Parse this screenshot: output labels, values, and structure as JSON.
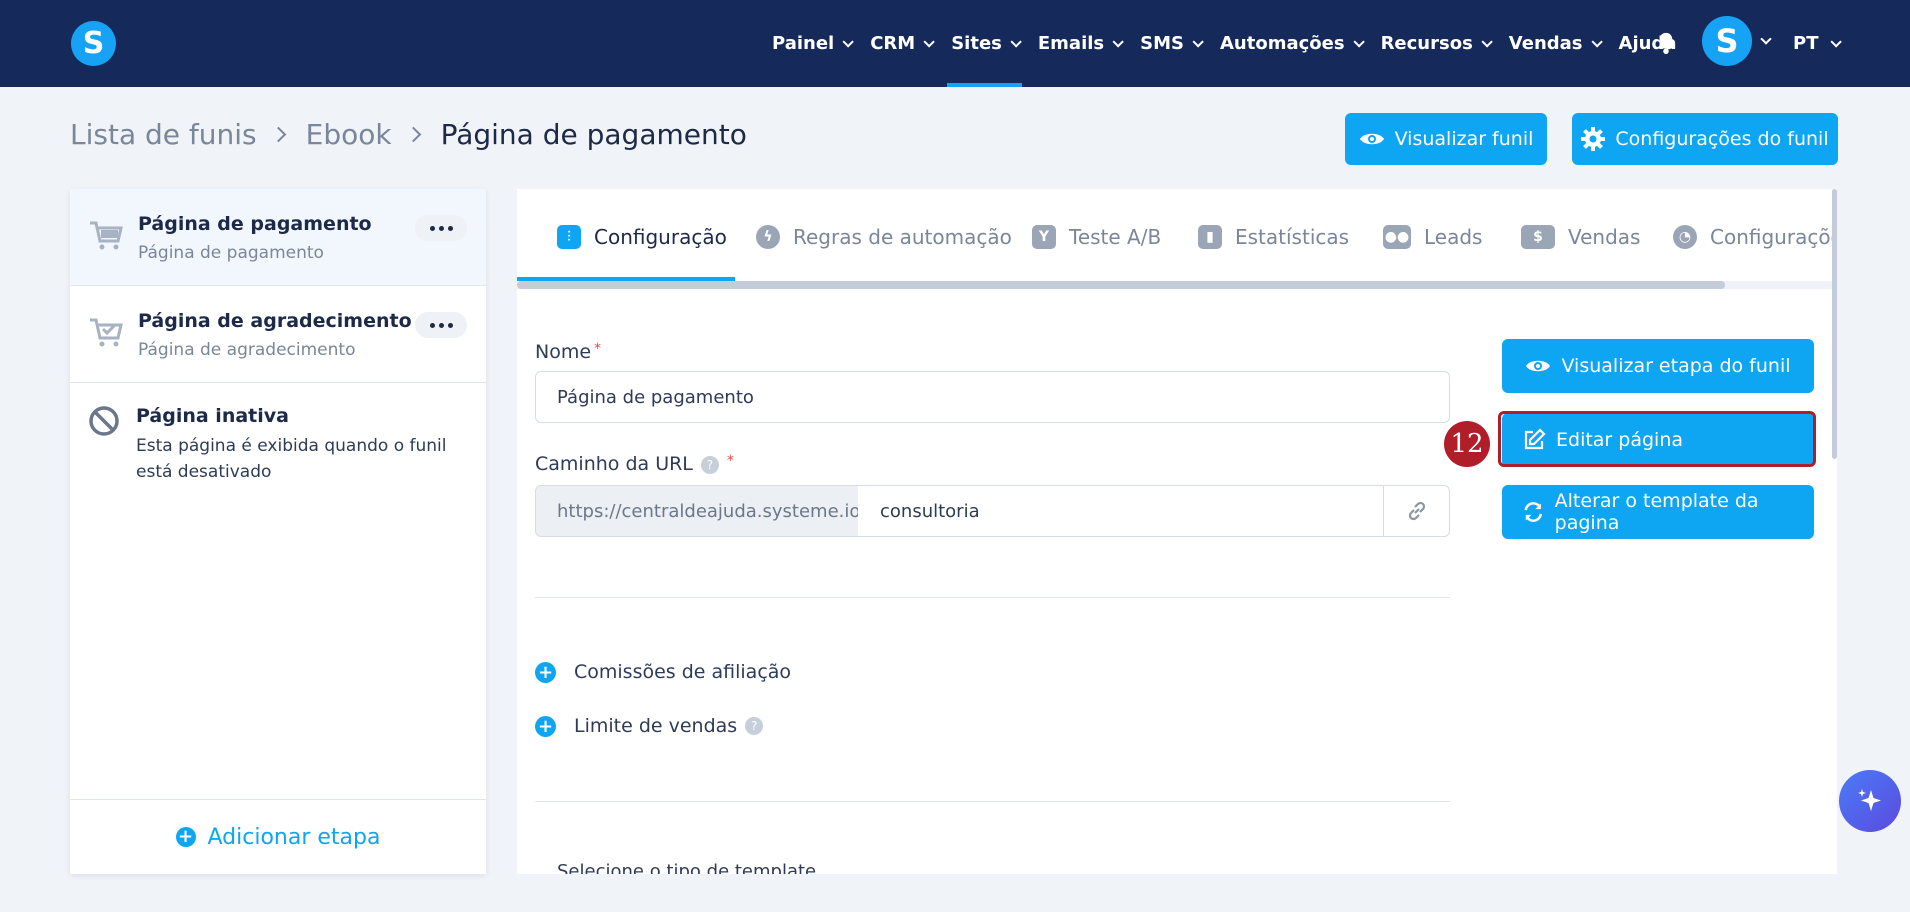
{
  "nav": {
    "items": [
      {
        "label": "Painel"
      },
      {
        "label": "CRM"
      },
      {
        "label": "Sites"
      },
      {
        "label": "Emails"
      },
      {
        "label": "SMS"
      },
      {
        "label": "Automações"
      },
      {
        "label": "Recursos"
      },
      {
        "label": "Vendas"
      },
      {
        "label": "Ajuda"
      }
    ],
    "active": "Sites",
    "logo_letter": "S",
    "avatar_letter": "S",
    "language": "PT"
  },
  "breadcrumb": {
    "items": [
      "Lista de funis",
      "Ebook",
      "Página de pagamento"
    ]
  },
  "header_buttons": {
    "preview_funnel": "Visualizar funil",
    "funnel_settings": "Configurações do funil"
  },
  "steps": [
    {
      "title": "Página de pagamento",
      "subtitle": "Página de pagamento",
      "selected": true
    },
    {
      "title": "Página de agradecimento",
      "subtitle": "Página de agradecimento",
      "selected": false
    }
  ],
  "inactive_page": {
    "title": "Página inativa",
    "description": "Esta página é exibida quando o funil está desativado"
  },
  "add_step": "Adicionar etapa",
  "tabs": [
    {
      "label": "Configuração",
      "icon": "sliders-icon",
      "active": true
    },
    {
      "label": "Regras de automação",
      "icon": "bolt-icon"
    },
    {
      "label": "Teste A/B",
      "icon": "split-icon"
    },
    {
      "label": "Estatísticas",
      "icon": "bar-chart-icon"
    },
    {
      "label": "Leads",
      "icon": "users-icon"
    },
    {
      "label": "Vendas",
      "icon": "dollar-icon"
    },
    {
      "label": "Configuraçõe",
      "icon": "clock-icon"
    }
  ],
  "form": {
    "name_label": "Nome",
    "name_value": "Página de pagamento",
    "url_label": "Caminho da URL",
    "url_prefix": "https://centraldeajuda.systeme.io/",
    "url_path": "consultoria",
    "affiliate_commissions": "Comissões de afiliação",
    "sales_limit": "Limite de vendas",
    "cut_off_text": "Selecione o tipo de template"
  },
  "actions": {
    "preview_step": "Visualizar etapa do funil",
    "edit_page": "Editar página",
    "change_template": "Alterar o template da pagina"
  },
  "annotation": {
    "step_number": "12"
  },
  "colors": {
    "nav_bg": "#152a5b",
    "accent": "#0ea5f3",
    "highlight": "#b01e2a"
  }
}
